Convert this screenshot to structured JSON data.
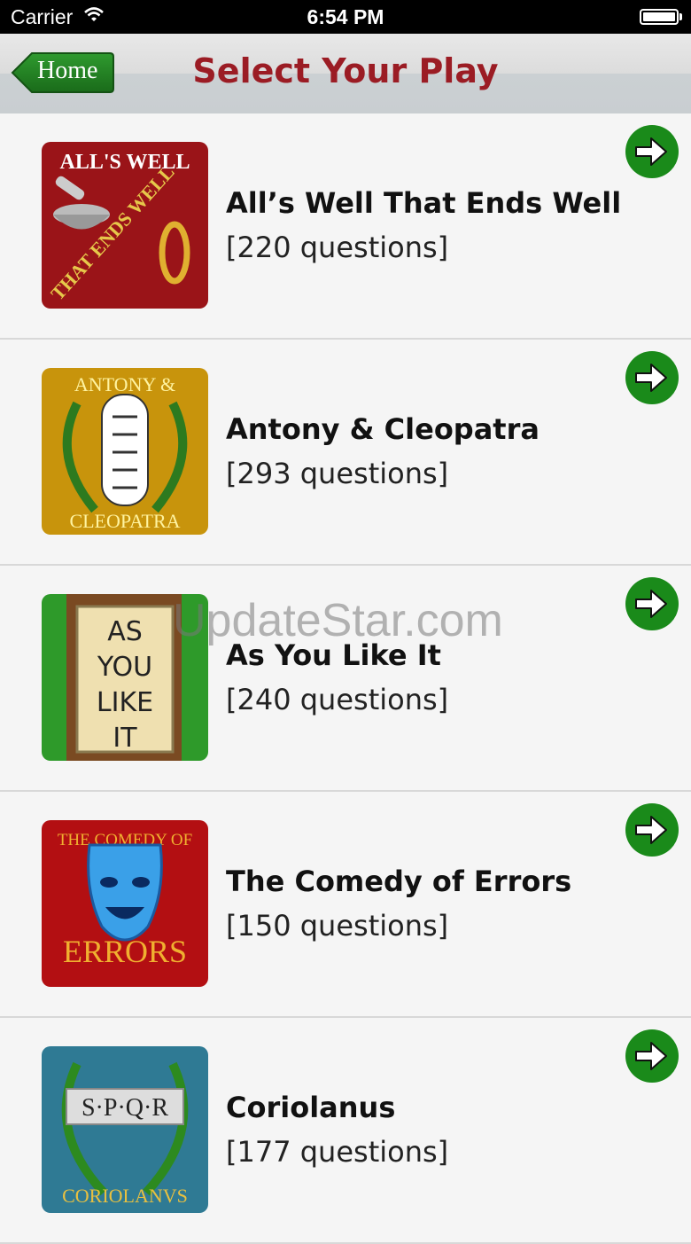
{
  "status_bar": {
    "carrier": "Carrier",
    "time": "6:54 PM"
  },
  "nav": {
    "back_label": "Home",
    "title": "Select Your Play"
  },
  "plays": [
    {
      "title": "All’s Well That Ends Well",
      "count": "[220 questions]",
      "art_text": [
        "ALL'S WELL",
        "THAT ENDS WELL"
      ]
    },
    {
      "title": "Antony & Cleopatra",
      "count": "[293 questions]",
      "art_text": [
        "ANTONY &",
        "CLEOPATRA"
      ]
    },
    {
      "title": "As You Like It",
      "count": "[240 questions]",
      "art_text": [
        "AS",
        "YOU",
        "LIKE",
        "IT"
      ]
    },
    {
      "title": "The Comedy of Errors",
      "count": "[150 questions]",
      "art_text": [
        "THE COMEDY OF",
        "ERRORS"
      ]
    },
    {
      "title": "Coriolanus",
      "count": "[177 questions]",
      "art_text": [
        "S·P·Q·R",
        "CORIOLANVS"
      ]
    }
  ],
  "watermark": "UpdateStar.com",
  "colors": {
    "nav_title": "#9b1c24",
    "home_button": "#1f7a1f",
    "arrow_button": "#1a8a1a"
  }
}
